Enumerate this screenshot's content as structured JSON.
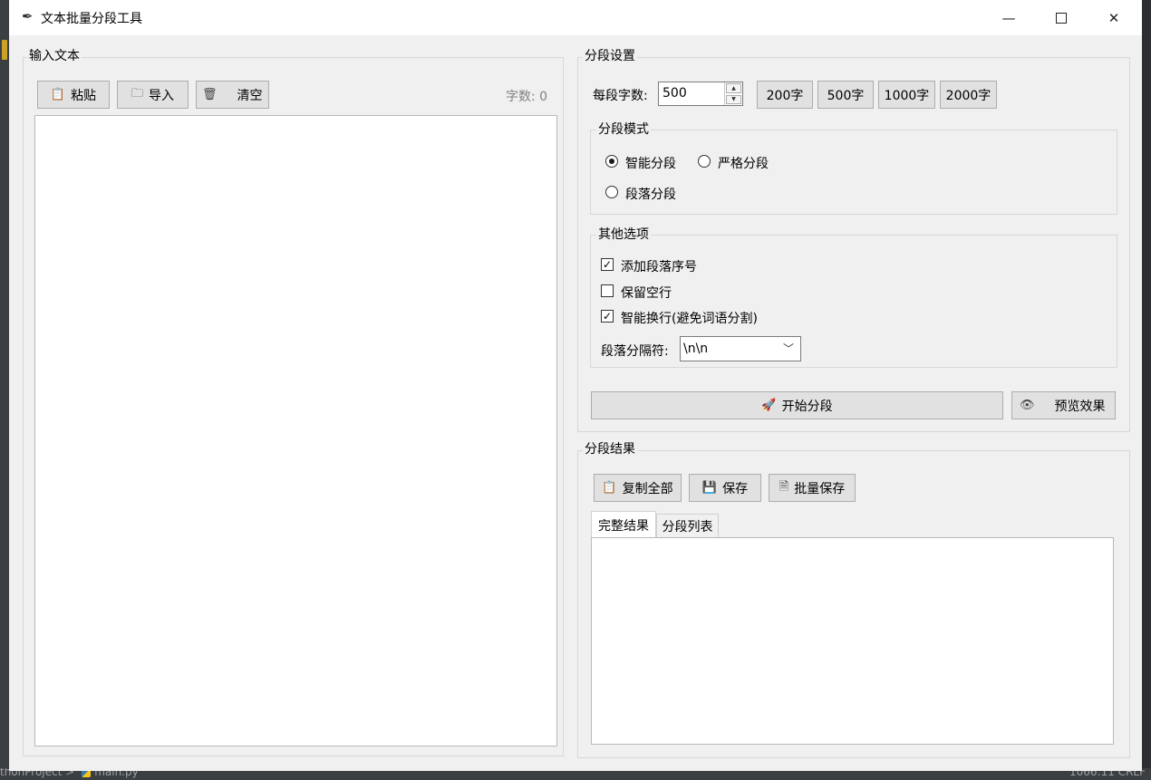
{
  "window": {
    "title": "文本批量分段工具"
  },
  "input": {
    "group_label": "输入文本",
    "paste_label": "粘贴",
    "import_label": "导入",
    "clear_label": "清空",
    "char_count": "字数: 0",
    "text": ""
  },
  "settings": {
    "group_label": "分段设置",
    "chars_per_segment_label": "每段字数:",
    "chars_per_segment_value": "500",
    "presets": [
      "200字",
      "500字",
      "1000字",
      "2000字"
    ],
    "mode": {
      "group_label": "分段模式",
      "options": [
        "智能分段",
        "严格分段",
        "段落分段"
      ],
      "selected": "智能分段"
    },
    "other": {
      "group_label": "其他选项",
      "add_numbers": {
        "label": "添加段落序号",
        "checked": true
      },
      "keep_blank": {
        "label": "保留空行",
        "checked": false
      },
      "smart_wrap": {
        "label": "智能换行(避免词语分割)",
        "checked": true
      },
      "separator_label": "段落分隔符:",
      "separator_value": "\\n\\n"
    },
    "start_label": "开始分段",
    "preview_label": "预览效果"
  },
  "result": {
    "group_label": "分段结果",
    "copy_all_label": "复制全部",
    "save_label": "保存",
    "batch_save_label": "批量保存",
    "tabs": [
      "完整结果",
      "分段列表"
    ],
    "active_tab": "完整结果",
    "text": ""
  },
  "ide": {
    "breadcrumb": "thonProject  >",
    "file": "main.py",
    "status_right": "1066:11    CRLF"
  }
}
